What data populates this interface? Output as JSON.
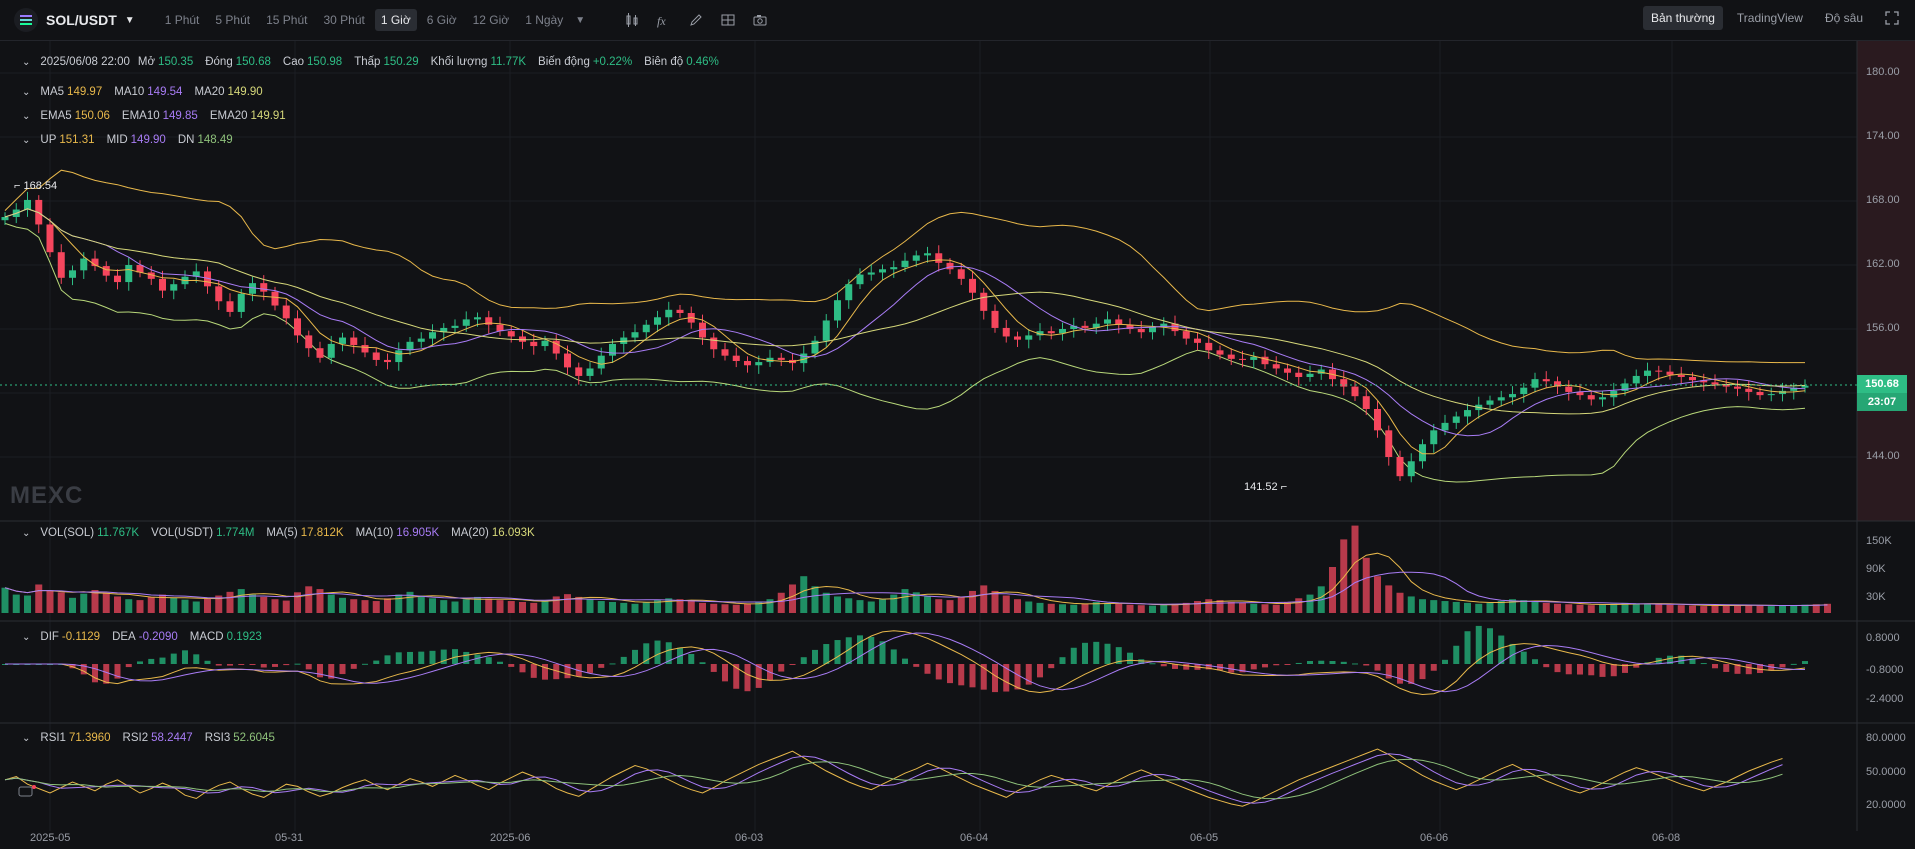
{
  "header": {
    "pair": "SOL/USDT",
    "timeframes": [
      "1 Phút",
      "5 Phút",
      "15 Phút",
      "30 Phút",
      "1 Giờ",
      "6 Giờ",
      "12 Giờ",
      "1 Ngày"
    ],
    "active_timeframe": "1 Giờ",
    "view_tabs": [
      "Bản thường",
      "TradingView",
      "Độ sâu"
    ],
    "active_view": "Bản thường"
  },
  "ohlc": {
    "date": "2025/06/08 22:00",
    "open_label": "Mở",
    "open": "150.35",
    "close_label": "Đóng",
    "close": "150.68",
    "high_label": "Cao",
    "high": "150.98",
    "low_label": "Thấp",
    "low": "150.29",
    "volume_label": "Khối lượng",
    "volume": "11.77K",
    "change_label": "Biến động",
    "change": "+0.22%",
    "amplitude_label": "Biên độ",
    "amplitude": "0.46%"
  },
  "ma": {
    "ma5_label": "MA5",
    "ma5": "149.97",
    "ma10_label": "MA10",
    "ma10": "149.54",
    "ma20_label": "MA20",
    "ma20": "149.90"
  },
  "ema": {
    "ema5_label": "EMA5",
    "ema5": "150.06",
    "ema10_label": "EMA10",
    "ema10": "149.85",
    "ema20_label": "EMA20",
    "ema20": "149.91"
  },
  "boll": {
    "up_label": "UP",
    "up": "151.31",
    "mid_label": "MID",
    "mid": "149.90",
    "dn_label": "DN",
    "dn": "148.49"
  },
  "vol": {
    "vol_sol_label": "VOL(SOL)",
    "vol_sol": "11.767K",
    "vol_usdt_label": "VOL(USDT)",
    "vol_usdt": "1.774M",
    "ma5_label": "MA(5)",
    "ma5": "17.812K",
    "ma10_label": "MA(10)",
    "ma10": "16.905K",
    "ma20_label": "MA(20)",
    "ma20": "16.093K"
  },
  "macd": {
    "dif_label": "DIF",
    "dif": "-0.1129",
    "dea_label": "DEA",
    "dea": "-0.2090",
    "macd_label": "MACD",
    "macd": "0.1923"
  },
  "rsi": {
    "rsi1_label": "RSI1",
    "rsi1": "71.3960",
    "rsi2_label": "RSI2",
    "rsi2": "58.2447",
    "rsi3_label": "RSI3",
    "rsi3": "52.6045"
  },
  "price_axis": [
    "180.00",
    "174.00",
    "168.00",
    "162.00",
    "156.00",
    "144.00"
  ],
  "vol_axis": [
    "150K",
    "90K",
    "30K"
  ],
  "macd_axis": [
    "0.8000",
    "-0.8000",
    "-2.4000"
  ],
  "rsi_axis": [
    "80.0000",
    "50.0000",
    "20.0000"
  ],
  "time_axis": [
    "2025-05",
    "05-31",
    "2025-06",
    "06-03",
    "06-04",
    "06-05",
    "06-06",
    "06-08"
  ],
  "last_price": "150.68",
  "countdown": "23:07",
  "high_marker": "168.54",
  "low_marker": "141.52",
  "watermark": "MEXC",
  "colors": {
    "up": "#2ebd85",
    "down": "#f6465d",
    "ma5": "#e8b84b",
    "ma10": "#a87cf5",
    "ma20": "#d6d87a"
  },
  "chart_data": {
    "type": "candlestick",
    "ylim": [
      138,
      183
    ],
    "y_ticks": [
      180,
      174,
      168,
      162,
      156,
      144
    ],
    "close_series": [
      166.5,
      167.2,
      168.1,
      165.8,
      163.2,
      160.8,
      161.5,
      162.6,
      161.9,
      161.0,
      160.4,
      162.0,
      161.3,
      160.7,
      159.6,
      160.2,
      160.9,
      161.4,
      160.0,
      158.6,
      157.6,
      159.3,
      160.3,
      159.5,
      158.2,
      157.0,
      155.4,
      154.2,
      153.3,
      154.6,
      155.2,
      154.5,
      153.8,
      153.1,
      152.9,
      154.0,
      154.8,
      155.1,
      155.7,
      156.1,
      156.3,
      156.9,
      157.1,
      156.4,
      155.8,
      155.3,
      154.8,
      154.4,
      154.9,
      153.7,
      152.4,
      151.6,
      152.3,
      153.5,
      154.6,
      155.2,
      155.7,
      156.4,
      157.1,
      157.8,
      157.5,
      156.6,
      155.2,
      154.1,
      153.5,
      153.0,
      152.6,
      152.9,
      153.3,
      153.1,
      152.8,
      153.7,
      154.9,
      156.8,
      158.7,
      160.2,
      161.1,
      161.3,
      161.6,
      161.8,
      162.4,
      162.9,
      163.1,
      162.2,
      161.6,
      160.7,
      159.4,
      157.7,
      156.1,
      155.3,
      155.0,
      155.4,
      155.8,
      155.6,
      156.0,
      156.3,
      156.1,
      156.5,
      156.9,
      156.4,
      156.0,
      155.7,
      156.2,
      156.5,
      155.8,
      155.1,
      154.7,
      154.0,
      153.6,
      153.2,
      153.1,
      153.4,
      152.7,
      152.3,
      151.9,
      151.5,
      151.8,
      152.2,
      151.3,
      150.6,
      149.7,
      148.5,
      146.5,
      144.0,
      142.2,
      143.6,
      145.2,
      146.5,
      147.2,
      147.8,
      148.4,
      148.9,
      149.3,
      149.6,
      149.9,
      150.5,
      151.3,
      151.1,
      150.6,
      150.1,
      149.8,
      149.4,
      149.6,
      150.2,
      150.9,
      151.6,
      152.1,
      152.0,
      151.7,
      151.5,
      151.2,
      151.0,
      150.8,
      150.6,
      150.4,
      150.1,
      149.8,
      149.9,
      150.2,
      150.5,
      150.68
    ],
    "volume_series": [
      55,
      40,
      38,
      62,
      48,
      45,
      33,
      42,
      50,
      44,
      36,
      30,
      28,
      35,
      40,
      33,
      29,
      25,
      31,
      38,
      46,
      52,
      40,
      35,
      30,
      27,
      45,
      58,
      52,
      40,
      33,
      30,
      28,
      26,
      32,
      40,
      46,
      38,
      32,
      28,
      25,
      30,
      35,
      31,
      28,
      26,
      24,
      22,
      28,
      36,
      41,
      35,
      30,
      26,
      24,
      22,
      20,
      24,
      28,
      32,
      30,
      26,
      22,
      20,
      19,
      18,
      20,
      24,
      30,
      44,
      62,
      80,
      58,
      44,
      36,
      32,
      28,
      25,
      30,
      40,
      52,
      45,
      36,
      30,
      28,
      34,
      48,
      60,
      48,
      38,
      30,
      25,
      22,
      20,
      19,
      18,
      20,
      24,
      22,
      20,
      18,
      17,
      16,
      18,
      20,
      22,
      26,
      30,
      28,
      24,
      22,
      20,
      19,
      18,
      24,
      32,
      40,
      58,
      100,
      160,
      190,
      120,
      80,
      60,
      44,
      36,
      30,
      28,
      26,
      24,
      22,
      20,
      22,
      26,
      30,
      28,
      24,
      22,
      20,
      19,
      18,
      17,
      18,
      20,
      22,
      21,
      20,
      19,
      18,
      17,
      16,
      15,
      16,
      17,
      18,
      17,
      16,
      15,
      16,
      17,
      18,
      19,
      20
    ],
    "rsi_series": [
      52,
      55,
      48,
      44,
      40,
      45,
      50,
      46,
      42,
      48,
      52,
      46,
      40,
      44,
      49,
      45,
      38,
      35,
      42,
      47,
      50,
      44,
      39,
      36,
      42,
      48,
      46,
      41,
      37,
      40,
      45,
      49,
      52,
      47,
      43,
      48,
      53,
      50,
      46,
      51,
      56,
      52,
      47,
      43,
      49,
      54,
      59,
      55,
      50,
      44,
      40,
      37,
      43,
      49,
      55,
      60,
      65,
      62,
      57,
      52,
      47,
      43,
      40,
      45,
      51,
      56,
      61,
      66,
      70,
      74,
      78,
      72,
      66,
      60,
      55,
      50,
      46,
      43,
      48,
      53,
      58,
      62,
      67,
      63,
      58,
      53,
      48,
      44,
      40,
      36,
      42,
      47,
      52,
      56,
      53,
      49,
      45,
      42,
      47,
      52,
      57,
      61,
      57,
      52,
      48,
      44,
      40,
      36,
      33,
      30,
      28,
      32,
      37,
      42,
      47,
      52,
      56,
      60,
      64,
      68,
      72,
      76,
      80,
      75,
      68,
      62,
      56,
      51,
      47,
      43,
      47,
      52,
      57,
      62,
      66,
      61,
      56,
      51,
      47,
      43,
      40,
      44,
      49,
      54,
      59,
      63,
      60,
      56,
      52,
      48,
      45,
      42,
      46,
      50,
      55,
      60,
      64,
      68,
      71.4
    ]
  }
}
